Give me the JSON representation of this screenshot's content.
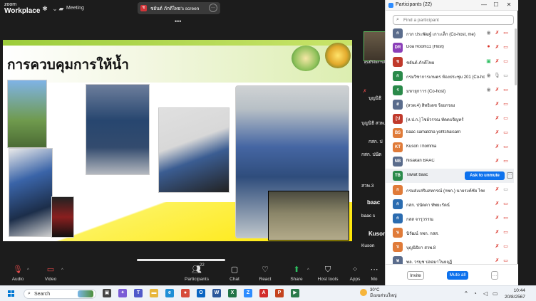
{
  "app": {
    "brand_top": "zoom",
    "brand_bottom": "Workplace",
    "meeting_label": "Meeting"
  },
  "share_banner": {
    "badge": "ช",
    "text": "ชยันต์ ภักดีไทย's screen",
    "more": "···"
  },
  "slide": {
    "title": "การควบคุมการให้น้ำ"
  },
  "tiles": [
    {
      "name": "ศุนย์วิจัยการสั…",
      "icon": "mic-muted-icon"
    },
    {
      "name": "บุญนิธิ",
      "icon": "mic-muted-icon"
    },
    {
      "name": "บุญนิธิ สวพ.8",
      "icon": "mic-muted-icon"
    },
    {
      "name": "กสก. ป",
      "icon": "none"
    },
    {
      "name": "กสก. ปนัด",
      "icon": "mic-muted-icon"
    },
    {
      "name": "สวพ.3",
      "icon": "mic-muted-icon"
    },
    {
      "name": "baac",
      "icon": "none"
    },
    {
      "name": "baac s",
      "icon": "mic-muted-icon"
    },
    {
      "name": "Kuson",
      "icon": "none"
    },
    {
      "name": "Kuson",
      "icon": "mic-muted-icon"
    }
  ],
  "toolbar": {
    "audio": "Audio",
    "video": "Video",
    "participants": "Participants",
    "participants_count": "22",
    "chat": "Chat",
    "react": "React",
    "share": "Share",
    "host_tools": "Host tools",
    "apps": "Apps",
    "more": "Mo"
  },
  "panel": {
    "title": "Participants (22)",
    "search_placeholder": "Find a participant",
    "unmute_label": "Ask to unmute",
    "invite": "Invite",
    "mute_all": "Mute all",
    "more": "···",
    "participants": [
      {
        "initials": "ก",
        "color": "#5a6c8c",
        "name": "กวก ประพัฒฐ์ เกาะเล็ก (Co-host, me)",
        "icons": [
          "shield-icon",
          "mic-muted-icon",
          "video-off-icon"
        ]
      },
      {
        "initials": "DR",
        "color": "#8b3fb8",
        "name": "Doa Room11 (Host)",
        "icons": [
          "record-icon",
          "mic-muted-icon",
          "video-off-icon"
        ]
      },
      {
        "initials": "ช",
        "color": "#c0392b",
        "name": "ชยันต์ ภักดีไทย",
        "icons": [
          "share-screen-icon",
          "mic-muted-icon",
          "video-off-icon"
        ]
      },
      {
        "initials": "ก",
        "color": "#2a8a4a",
        "name": "กรมวิชาการเกษตร ห้องประชุม 201 (Co-host)",
        "icons": [
          "shield-icon",
          "mic-on-icon",
          "video-on-icon"
        ]
      },
      {
        "initials": "ร",
        "color": "#2a8a4a",
        "name": "มหายุกาาร (Co-host)",
        "icons": [
          "shield-icon",
          "mic-muted-icon",
          "video-off-icon"
        ]
      },
      {
        "initials": "ส",
        "color": "#5a6c8c",
        "name": "(สวพ.4) สิทธิเดช ร้อยกรอง",
        "icons": [
          "mic-muted-icon",
          "video-off-icon"
        ]
      },
      {
        "initials": "[ป",
        "color": "#c0392b",
        "name": "[ห.ป.ก.] ไชย์วรรณ ทัดดบจิญทร์",
        "icons": [
          "mic-muted-icon",
          "video-off-icon"
        ]
      },
      {
        "initials": "BS",
        "color": "#e07b39",
        "name": "baac samatcha yohtchaisarn",
        "icons": [
          "mic-muted-icon",
          "video-off-icon"
        ]
      },
      {
        "initials": "KT",
        "color": "#e07b39",
        "name": "Kuson Thomma",
        "icons": [
          "mic-muted-icon",
          "video-off-icon"
        ]
      },
      {
        "initials": "NB",
        "color": "#5a6c8c",
        "name": "Nisakan BAAC",
        "icons": [
          "mic-muted-icon",
          "video-off-icon"
        ]
      },
      {
        "initials": "TB",
        "color": "#2a8a4a",
        "name": "Tawat baac",
        "icons": []
      },
      {
        "initials": "ก",
        "color": "#e07b39",
        "name": "กรมส่งเสริมสหกรณ์ (กพก.) นายรงค์ชัย ไชยไธ",
        "icons": [
          "mic-muted-icon",
          "video-on-icon"
        ]
      },
      {
        "initials": "ก",
        "color": "#2b6cb0",
        "name": "กสก. ปนัดดา ทัพยะรัตน์",
        "icons": [
          "mic-muted-icon",
          "video-off-icon"
        ]
      },
      {
        "initials": "ก",
        "color": "#2b6cb0",
        "name": "กสส จารุวรรณ",
        "icons": [
          "mic-muted-icon",
          "video-off-icon"
        ]
      },
      {
        "initials": "น",
        "color": "#e07b39",
        "name": "นิรัฒน์ กพก. กสส.",
        "icons": [
          "mic-muted-icon",
          "video-off-icon"
        ]
      },
      {
        "initials": "บ",
        "color": "#e07b39",
        "name": "บุญนิธิยา สวพ.8",
        "icons": [
          "mic-muted-icon",
          "video-off-icon"
        ]
      },
      {
        "initials": "พ",
        "color": "#5a6c8c",
        "name": "พล. วรบุช ปลอมาโนยฤฏี",
        "icons": [
          "mic-muted-icon",
          "video-off-icon"
        ]
      }
    ]
  },
  "taskbar": {
    "search": "Search",
    "weather_temp": "30°C",
    "weather_desc": "มีเมฆส่วนใหญ่",
    "time": "10:44",
    "date": "20/8/2567",
    "apps": [
      {
        "name": "task-view-icon",
        "color": "#444",
        "glyph": "▣"
      },
      {
        "name": "copilot-icon",
        "color": "#7b5cd6",
        "glyph": "✦"
      },
      {
        "name": "teams-icon",
        "color": "#5059c9",
        "glyph": "T"
      },
      {
        "name": "file-explorer-icon",
        "color": "#e8b63a",
        "glyph": "▬"
      },
      {
        "name": "edge-icon",
        "color": "#1f8fd6",
        "glyph": "e"
      },
      {
        "name": "chrome-icon",
        "color": "#d64b3a",
        "glyph": "●"
      },
      {
        "name": "outlook-icon",
        "color": "#0a64c2",
        "glyph": "O"
      },
      {
        "name": "word-icon",
        "color": "#2b579a",
        "glyph": "W"
      },
      {
        "name": "excel-icon",
        "color": "#217346",
        "glyph": "X"
      },
      {
        "name": "zoom-icon",
        "color": "#2d8cff",
        "glyph": "Z"
      },
      {
        "name": "acrobat-icon",
        "color": "#d22b2b",
        "glyph": "A"
      },
      {
        "name": "powerpoint-icon",
        "color": "#c4431f",
        "glyph": "P"
      },
      {
        "name": "media-icon",
        "color": "#2b7a4b",
        "glyph": "▶"
      }
    ]
  }
}
